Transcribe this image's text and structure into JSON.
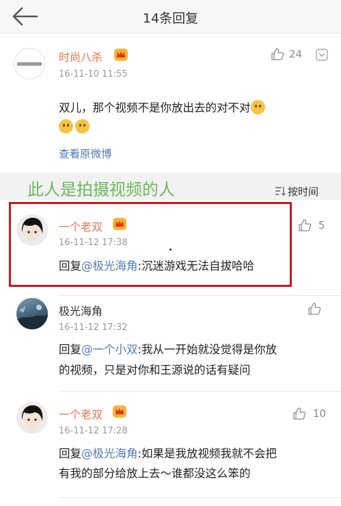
{
  "header": {
    "title": "14条回复"
  },
  "original_post": {
    "author": "时尚八杀",
    "time": "16-11-10 11:55",
    "likes": "24",
    "text": "双儿，那个视频不是你放出去的对不对",
    "view_original": "查看原微博"
  },
  "annotation": {
    "text": "此人是拍摄视频的人"
  },
  "sort": {
    "label": "按时间"
  },
  "replies": [
    {
      "author": "一个老双",
      "time": "16-11-12 17:38",
      "likes": "5",
      "prefix": "回复",
      "mention": "@极光海角",
      "text": ":沉迷游戏无法自拔哈哈"
    },
    {
      "author": "极光海角",
      "time": "16-11-12 17:32",
      "likes": "",
      "prefix": "回复",
      "mention": "@一个小双",
      "text_line1": ":我从一开始就没觉得是你放",
      "text_line2": "的视频，只是对你和王源说的话有疑问"
    },
    {
      "author": "一个老双",
      "time": "16-11-12 17:28",
      "likes": "10",
      "prefix": "回复",
      "mention": "@极光海角",
      "text_line1": ":如果是我放视频我就不会把",
      "text_line2": "有我的部分给放上去～谁都没这么笨的"
    }
  ],
  "colors": {
    "accent_orange": "#eb7350",
    "link_blue": "#507daf",
    "annotation_green": "#6cb85c",
    "highlight_red": "#c8161d"
  },
  "icons": [
    "back-arrow-icon",
    "vip-crown-icon",
    "like-thumb-icon",
    "more-chevron-icon",
    "sort-icon",
    "emoji-icon"
  ]
}
